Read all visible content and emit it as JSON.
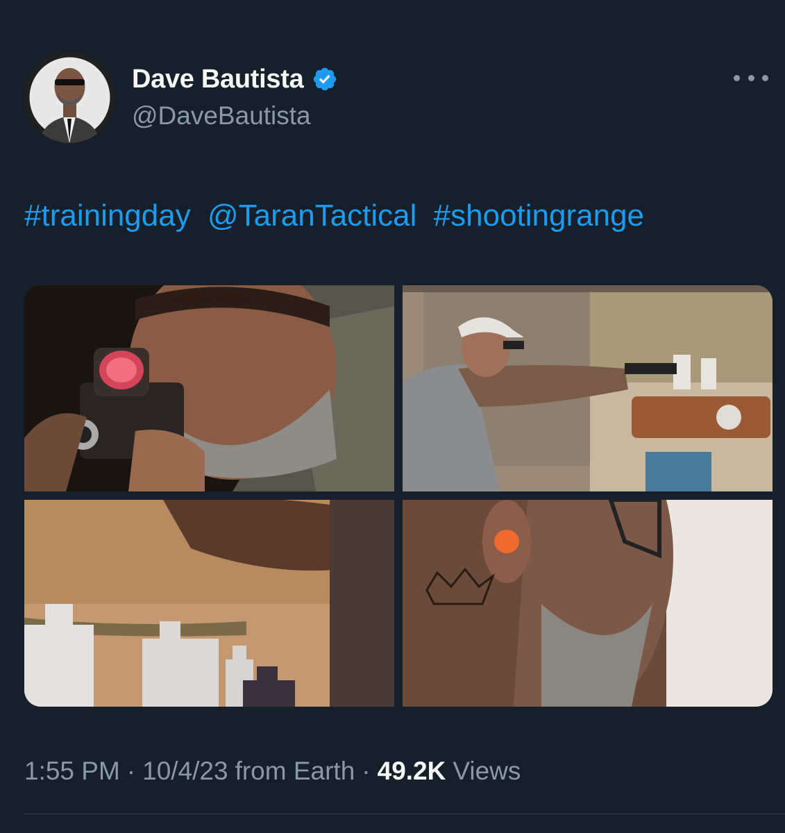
{
  "author": {
    "display_name": "Dave Bautista",
    "handle": "@DaveBautista",
    "verified_icon": "verified-badge-icon",
    "verified_color": "#1d9bf0"
  },
  "more_icon": "more-options-icon",
  "tweet": {
    "segments": [
      "#trainingday",
      "@TaranTactical",
      "#shootingrange"
    ],
    "link_color": "#1d9bf0"
  },
  "media": {
    "photos": [
      "photo-1",
      "photo-2",
      "photo-3",
      "photo-4"
    ]
  },
  "meta": {
    "time": "1:55 PM",
    "separator": "·",
    "date": "10/4/23",
    "source": "from Earth",
    "views_count": "49.2K",
    "views_label": "Views"
  },
  "colors": {
    "background": "#15202b",
    "secondary_text": "#8b98a5",
    "primary_text": "#f7f9f9"
  }
}
